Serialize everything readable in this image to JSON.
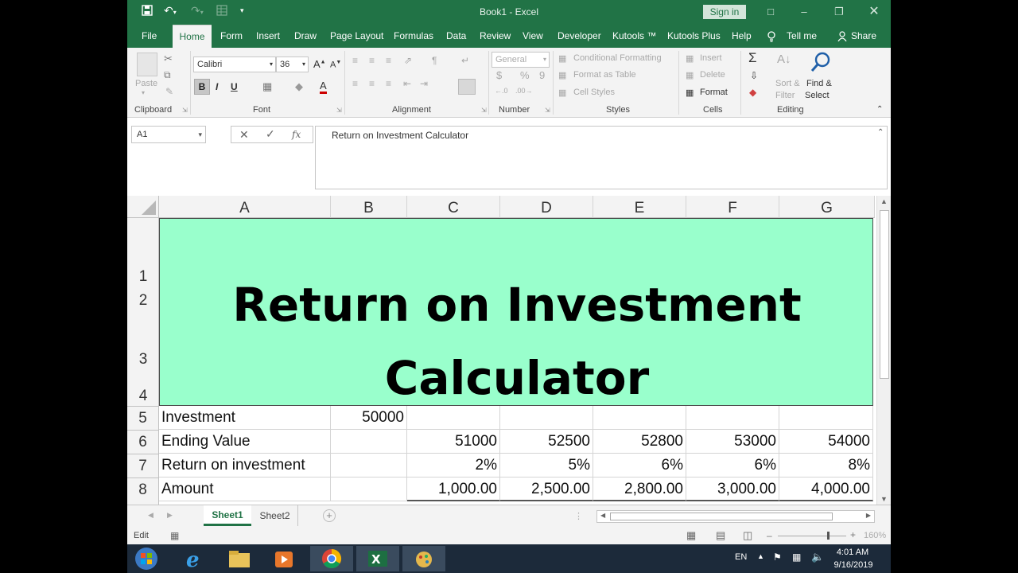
{
  "app": {
    "title": "Book1 - Excel",
    "signin": "Sign in"
  },
  "tabs": [
    "File",
    "Home",
    "Form",
    "Insert",
    "Draw",
    "Page Layout",
    "Formulas",
    "Data",
    "Review",
    "View",
    "Developer",
    "Kutools ™",
    "Kutools Plus",
    "Help"
  ],
  "tell_me": "Tell me",
  "share": "Share",
  "ribbon": {
    "clipboard": {
      "paste": "Paste",
      "label": "Clipboard"
    },
    "font": {
      "name": "Calibri",
      "size": "36",
      "label": "Font",
      "bold": "B",
      "italic": "I",
      "underline": "U"
    },
    "alignment": {
      "label": "Alignment"
    },
    "number": {
      "format": "General",
      "label": "Number",
      "currency": "$",
      "percent": "%",
      "comma": "9"
    },
    "styles": {
      "conditional": "Conditional Formatting",
      "table": "Format as Table",
      "cell": "Cell Styles",
      "label": "Styles"
    },
    "cells": {
      "insert": "Insert",
      "delete": "Delete",
      "format": "Format",
      "label": "Cells"
    },
    "editing": {
      "sort1": "Sort &",
      "sort2": "Filter",
      "find1": "Find &",
      "find2": "Select",
      "label": "Editing"
    }
  },
  "formula_bar": {
    "name_box": "A1",
    "content": "Return on Investment Calculator",
    "fx": "fx"
  },
  "sheet": {
    "columns": [
      "A",
      "B",
      "C",
      "D",
      "E",
      "F",
      "G"
    ],
    "rows": [
      "1",
      "2",
      "3",
      "4",
      "5",
      "6",
      "7",
      "8"
    ],
    "title_line1": "Return on Investment",
    "title_line2": "Calculator",
    "labels": [
      "Investment",
      "Ending Value",
      "Return on investment",
      "Amount"
    ],
    "investment": "50000",
    "ending_values": [
      "51000",
      "52500",
      "52800",
      "53000",
      "54000"
    ],
    "returns": [
      "2%",
      "5%",
      "6%",
      "6%",
      "8%"
    ],
    "amounts": [
      "1,000.00",
      "2,500.00",
      "2,800.00",
      "3,000.00",
      "4,000.00"
    ]
  },
  "sheet_tabs": [
    "Sheet1",
    "Sheet2"
  ],
  "status": {
    "mode": "Edit",
    "zoom": "160%"
  },
  "taskbar": {
    "lang": "EN",
    "time": "4:01 AM",
    "date": "9/16/2019"
  },
  "colors": {
    "excel_green": "#217346",
    "banner": "#99ffcc"
  }
}
